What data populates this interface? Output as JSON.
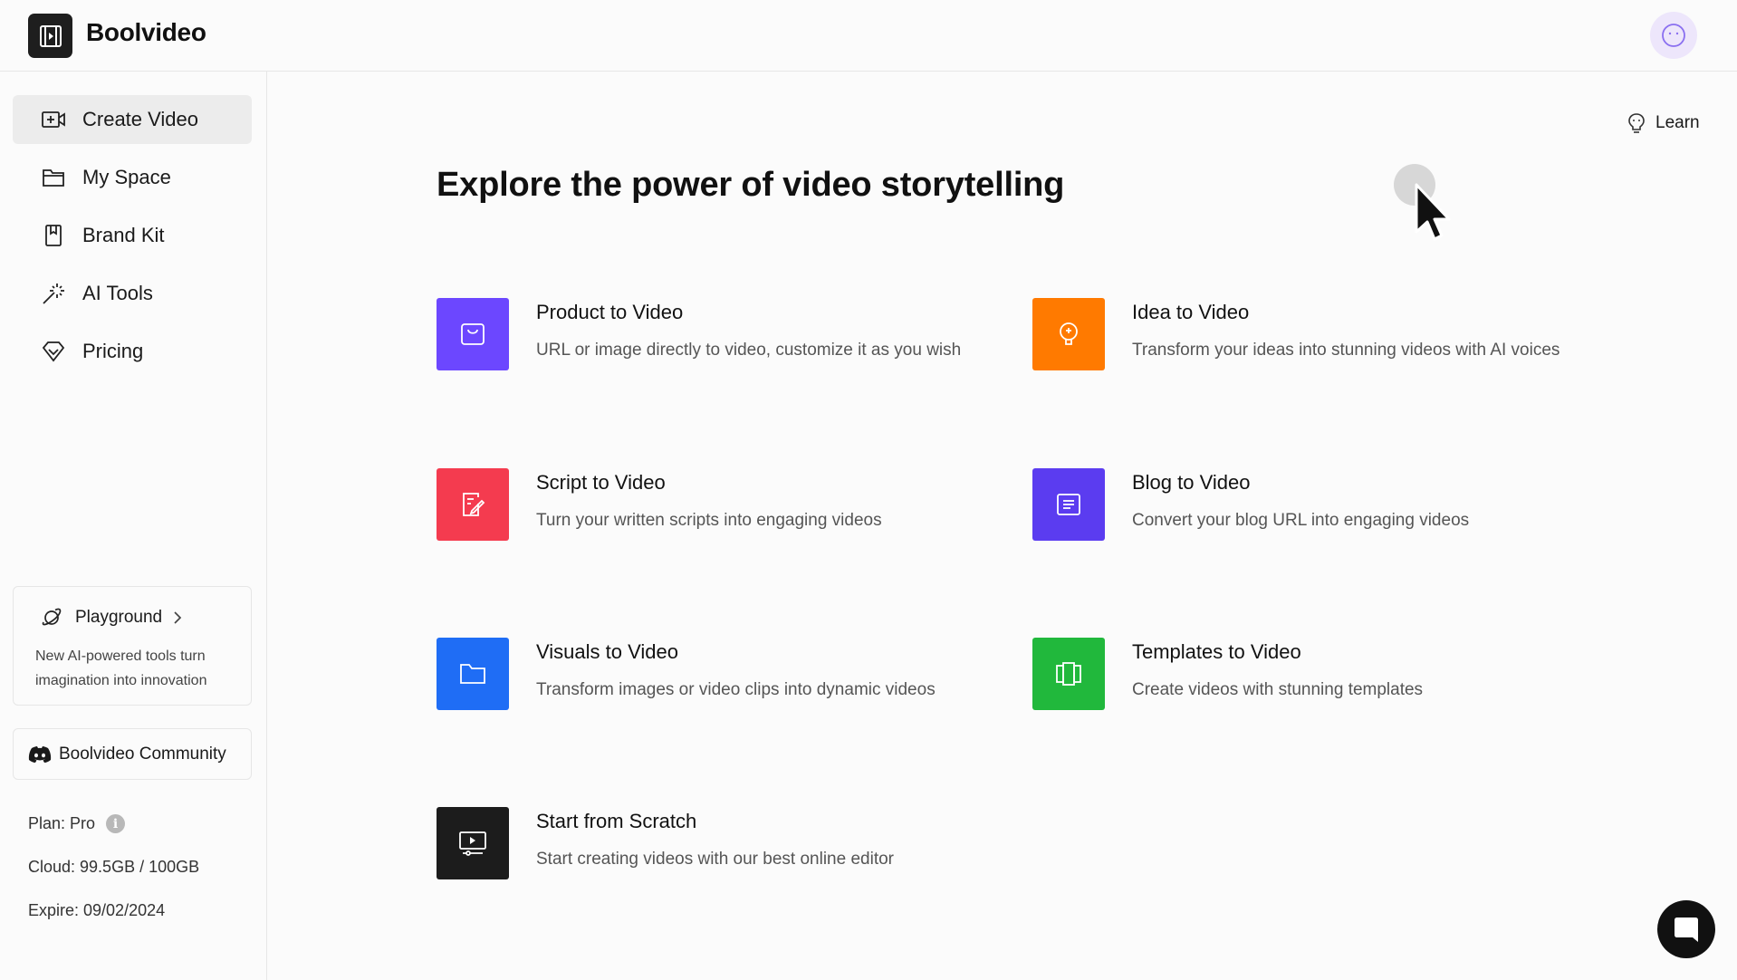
{
  "app": {
    "brand": "Boolvideo"
  },
  "sidebar": {
    "items": [
      {
        "label": "Create Video",
        "icon": "video-plus-icon"
      },
      {
        "label": "My Space",
        "icon": "folder-icon"
      },
      {
        "label": "Brand Kit",
        "icon": "bookmark-icon"
      },
      {
        "label": "AI Tools",
        "icon": "magic-wand-icon"
      },
      {
        "label": "Pricing",
        "icon": "diamond-icon"
      }
    ],
    "playground": {
      "title": "Playground",
      "description": "New AI-powered tools turn imagination into innovation"
    },
    "community": "Boolvideo Community",
    "plan": "Plan: Pro",
    "cloud": "Cloud: 99.5GB / 100GB",
    "expire": "Expire: 09/02/2024"
  },
  "main": {
    "learn": "Learn",
    "title": "Explore the power of video storytelling",
    "cards": [
      {
        "title": "Product to Video",
        "desc": "URL or image directly to video, customize it as you wish",
        "color": "#6c47ff",
        "icon": "shopping-bag-icon"
      },
      {
        "title": "Idea to Video",
        "desc": "Transform your ideas into stunning videos with AI voices",
        "color": "#ff7a00",
        "icon": "lightbulb-icon"
      },
      {
        "title": "Script to Video",
        "desc": "Turn your written scripts into engaging videos",
        "color": "#f43b4f",
        "icon": "script-edit-icon"
      },
      {
        "title": "Blog to Video",
        "desc": "Convert your blog URL into engaging videos",
        "color": "#5b3cf0",
        "icon": "document-icon"
      },
      {
        "title": "Visuals to Video",
        "desc": "Transform images or video clips into dynamic videos",
        "color": "#1f6df5",
        "icon": "folder-icon"
      },
      {
        "title": "Templates to Video",
        "desc": "Create videos with stunning templates",
        "color": "#21b83c",
        "icon": "template-icon"
      },
      {
        "title": "Start from Scratch",
        "desc": "Start creating videos with our best online editor",
        "color": "#1c1c1c",
        "icon": "monitor-play-icon"
      }
    ]
  },
  "colors": {
    "active_nav_bg": "#ececec",
    "avatar_bg": "#ede6fb",
    "avatar_accent": "#8a6ff0"
  }
}
